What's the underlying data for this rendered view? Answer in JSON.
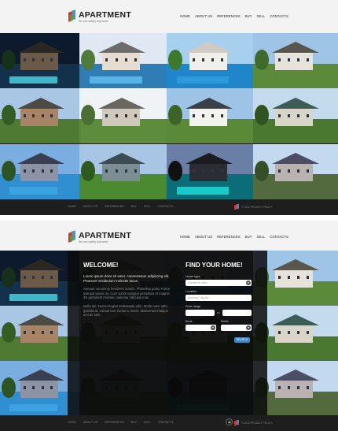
{
  "brand": {
    "title": "APARTMENT",
    "tagline": "We can satisfy any taste!"
  },
  "nav": [
    "Home",
    "About Us",
    "References",
    "Buy",
    "Sell",
    "Contacts"
  ],
  "footer": {
    "nav": [
      "Home",
      "About Us",
      "References",
      "Buy",
      "Sell",
      "Contacts"
    ],
    "copyright": "© 2012 PRIVACY POLICY"
  },
  "welcome": {
    "heading": "WELCOME!",
    "lead": "Lorem ipsum dolor sit amet, consectetuer adipiscing elit. Praesent vestibulum molestie lacus.",
    "body1": "Aenean nonummy hendrerit mauris. Phasellus porta. Fusce suscipit varius mi. Cum sociis natoque penatibus et magnis dis parturient montes, nascetur ridiculus mus.",
    "body2": "Nulla dui. Fusce feugiat malesuada odio. Morbi nunc odio, gravida at, cursus nec, luctus a, lorem. Maecenas tristique orci ac sem."
  },
  "finder": {
    "heading": "FIND YOUR HOME!",
    "home_type_label": "Home type",
    "home_type_value": "Homes for sale",
    "location_label": "Location",
    "location_placeholder": "Address City Zip",
    "price_label": "Price range",
    "price_separator": "to",
    "beds_label": "Beds",
    "baths_label": "Baths",
    "search_label": "Search"
  },
  "colors": {
    "header_bg": "#f3f3f3",
    "footer_bg": "#1e1e1e",
    "accent": "#3f86c2",
    "logo_red": "#d9362f",
    "logo_blue": "#2f8fc9",
    "logo_green": "#44a540"
  }
}
